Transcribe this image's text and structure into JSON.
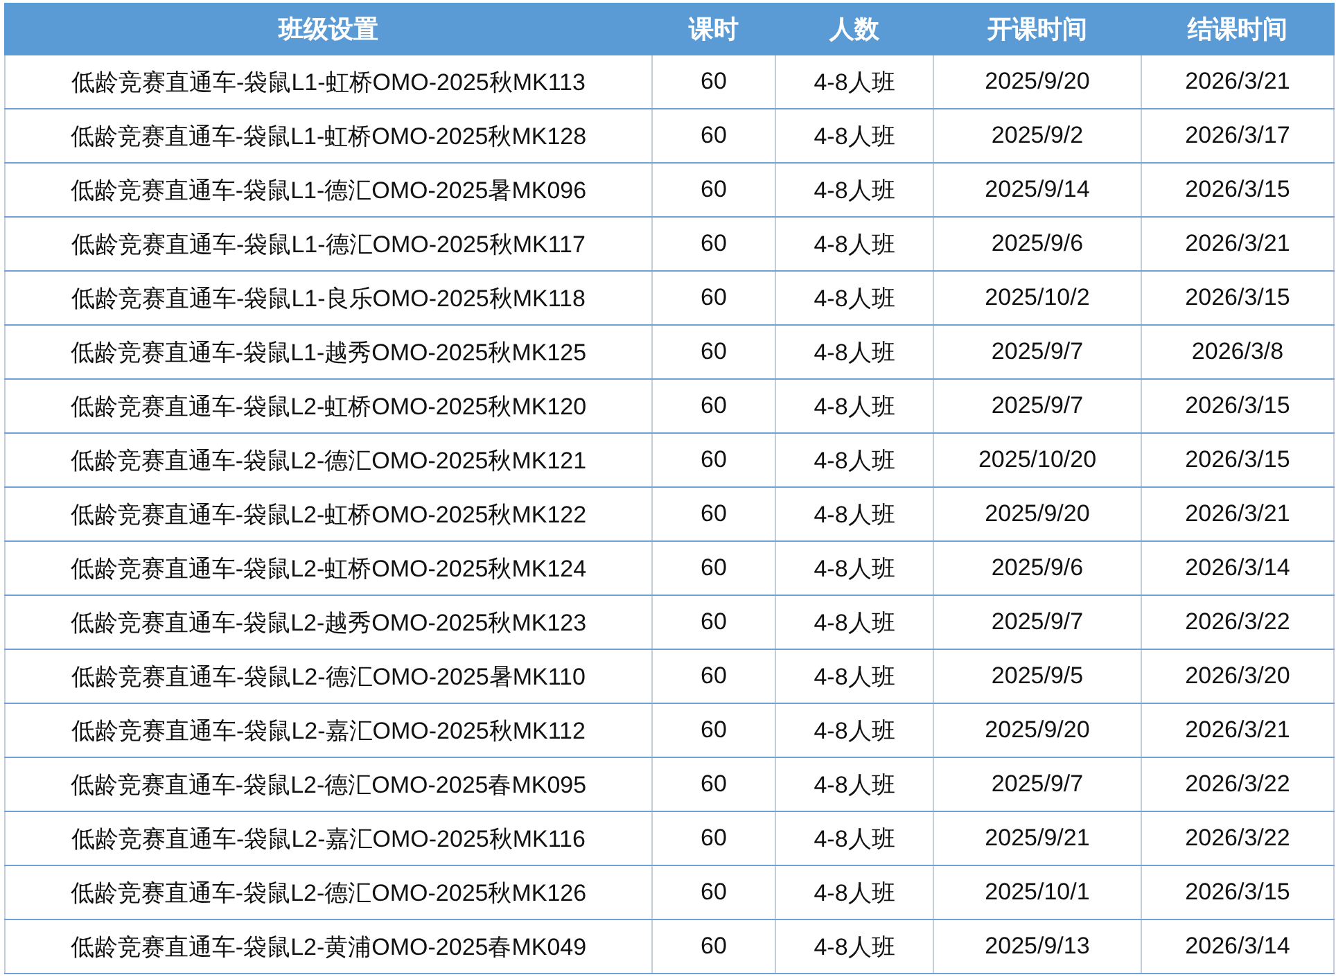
{
  "table": {
    "columns": [
      "班级设置",
      "课时",
      "人数",
      "开课时间",
      "结课时间"
    ],
    "rows": [
      [
        "低龄竞赛直通车-袋鼠L1-虹桥OMO-2025秋MK113",
        "60",
        "4-8人班",
        "2025/9/20",
        "2026/3/21"
      ],
      [
        "低龄竞赛直通车-袋鼠L1-虹桥OMO-2025秋MK128",
        "60",
        "4-8人班",
        "2025/9/2",
        "2026/3/17"
      ],
      [
        "低龄竞赛直通车-袋鼠L1-德汇OMO-2025暑MK096",
        "60",
        "4-8人班",
        "2025/9/14",
        "2026/3/15"
      ],
      [
        "低龄竞赛直通车-袋鼠L1-德汇OMO-2025秋MK117",
        "60",
        "4-8人班",
        "2025/9/6",
        "2026/3/21"
      ],
      [
        "低龄竞赛直通车-袋鼠L1-良乐OMO-2025秋MK118",
        "60",
        "4-8人班",
        "2025/10/2",
        "2026/3/15"
      ],
      [
        "低龄竞赛直通车-袋鼠L1-越秀OMO-2025秋MK125",
        "60",
        "4-8人班",
        "2025/9/7",
        "2026/3/8"
      ],
      [
        "低龄竞赛直通车-袋鼠L2-虹桥OMO-2025秋MK120",
        "60",
        "4-8人班",
        "2025/9/7",
        "2026/3/15"
      ],
      [
        "低龄竞赛直通车-袋鼠L2-德汇OMO-2025秋MK121",
        "60",
        "4-8人班",
        "2025/10/20",
        "2026/3/15"
      ],
      [
        "低龄竞赛直通车-袋鼠L2-虹桥OMO-2025秋MK122",
        "60",
        "4-8人班",
        "2025/9/20",
        "2026/3/21"
      ],
      [
        "低龄竞赛直通车-袋鼠L2-虹桥OMO-2025秋MK124",
        "60",
        "4-8人班",
        "2025/9/6",
        "2026/3/14"
      ],
      [
        "低龄竞赛直通车-袋鼠L2-越秀OMO-2025秋MK123",
        "60",
        "4-8人班",
        "2025/9/7",
        "2026/3/22"
      ],
      [
        "低龄竞赛直通车-袋鼠L2-德汇OMO-2025暑MK110",
        "60",
        "4-8人班",
        "2025/9/5",
        "2026/3/20"
      ],
      [
        "低龄竞赛直通车-袋鼠L2-嘉汇OMO-2025秋MK112",
        "60",
        "4-8人班",
        "2025/9/20",
        "2026/3/21"
      ],
      [
        "低龄竞赛直通车-袋鼠L2-德汇OMO-2025春MK095",
        "60",
        "4-8人班",
        "2025/9/7",
        "2026/3/22"
      ],
      [
        "低龄竞赛直通车-袋鼠L2-嘉汇OMO-2025秋MK116",
        "60",
        "4-8人班",
        "2025/9/21",
        "2026/3/22"
      ],
      [
        "低龄竞赛直通车-袋鼠L2-德汇OMO-2025秋MK126",
        "60",
        "4-8人班",
        "2025/10/1",
        "2026/3/15"
      ],
      [
        "低龄竞赛直通车-袋鼠L2-黄浦OMO-2025春MK049",
        "60",
        "4-8人班",
        "2025/9/13",
        "2026/3/14"
      ]
    ]
  }
}
